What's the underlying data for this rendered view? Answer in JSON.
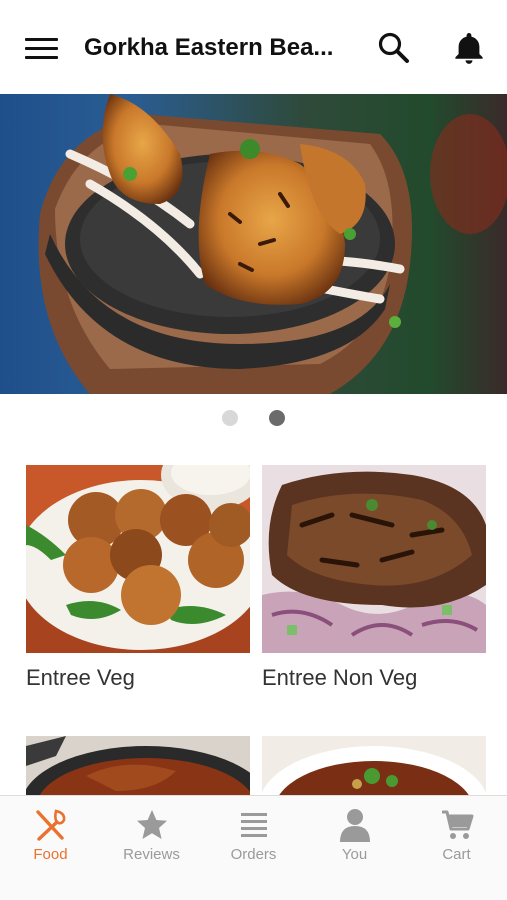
{
  "header": {
    "title": "Gorkha Eastern Bea...",
    "icons": [
      "menu-icon",
      "search-icon",
      "bell-icon"
    ]
  },
  "carousel": {
    "page_count": 2,
    "active_page": 2
  },
  "categories": [
    {
      "label": "Entree Veg"
    },
    {
      "label": "Entree Non Veg"
    },
    {
      "label": ""
    },
    {
      "label": ""
    }
  ],
  "tabbar": {
    "active_color": "#e8722e",
    "inactive_color": "#9a9a9a",
    "items": [
      {
        "label": "Food",
        "icon": "fork-knife-icon"
      },
      {
        "label": "Reviews",
        "icon": "star-icon"
      },
      {
        "label": "Orders",
        "icon": "list-icon"
      },
      {
        "label": "You",
        "icon": "user-icon"
      },
      {
        "label": "Cart",
        "icon": "cart-icon"
      }
    ]
  }
}
